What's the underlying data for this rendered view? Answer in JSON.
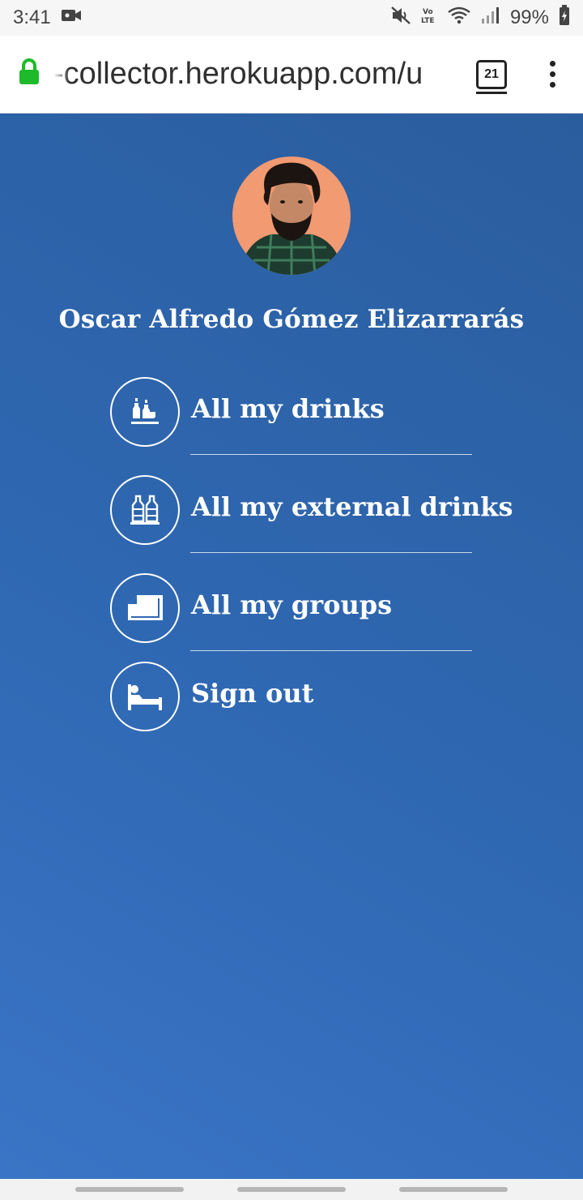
{
  "status_bar": {
    "time": "3:41",
    "battery": "99%",
    "icons": [
      "video-call-icon",
      "mute-icon",
      "volte-icon",
      "wifi-icon",
      "signal-icon",
      "battery-charging-icon"
    ]
  },
  "browser": {
    "url": "-collector.herokuapp.com/u",
    "tab_count": "21",
    "colors": {
      "lock": "#1dbb2a"
    }
  },
  "profile": {
    "name": "Oscar Alfredo Gómez Elizarrarás",
    "avatar_icon": "user-avatar-photo"
  },
  "menu": {
    "items": [
      {
        "label": "All my drinks",
        "icon": "drinks-icon"
      },
      {
        "label": "All my external drinks",
        "icon": "bottles-icon"
      },
      {
        "label": "All my groups",
        "icon": "groups-icon"
      },
      {
        "label": "Sign out",
        "icon": "bed-icon"
      }
    ]
  },
  "colors": {
    "background_start": "#3a74c6",
    "background_end": "#2a5d9e",
    "text": "#ffffff"
  }
}
